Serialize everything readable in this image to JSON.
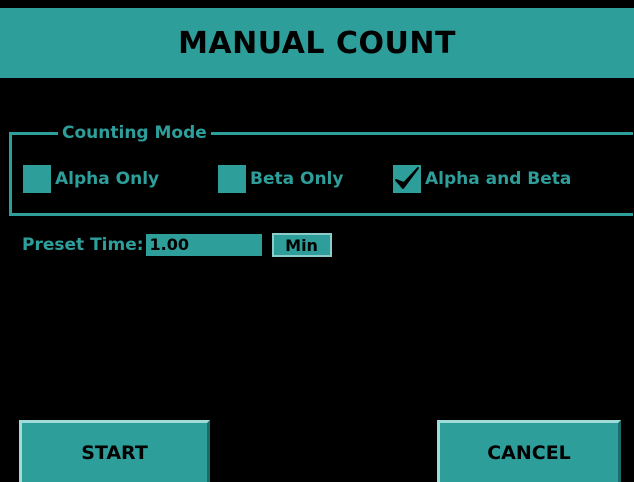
{
  "header": {
    "title": "MANUAL COUNT"
  },
  "counting_mode": {
    "legend": "Counting Mode",
    "options": [
      {
        "label": "Alpha Only",
        "checked": false
      },
      {
        "label": "Beta Only",
        "checked": false
      },
      {
        "label": "Alpha and Beta",
        "checked": true
      }
    ]
  },
  "preset": {
    "label": "Preset Time:",
    "value": "1.00",
    "unit": "Min"
  },
  "buttons": {
    "start": "START",
    "cancel": "CANCEL"
  },
  "colors": {
    "accent": "#2e9e9b",
    "background": "#000000",
    "text_on_accent": "#000000"
  }
}
